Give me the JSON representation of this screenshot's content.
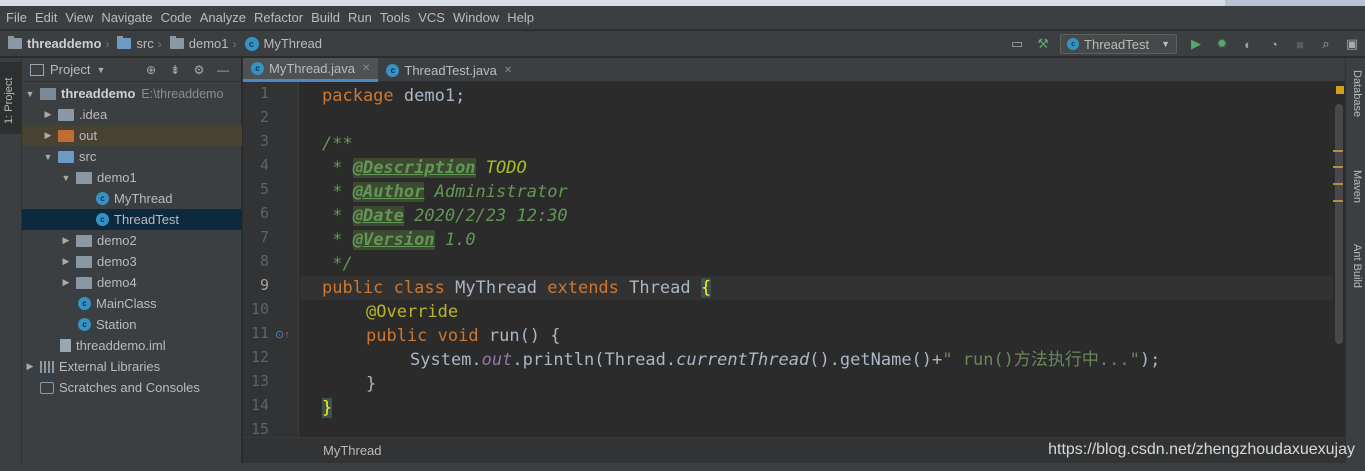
{
  "menu": [
    "File",
    "Edit",
    "View",
    "Navigate",
    "Code",
    "Analyze",
    "Refactor",
    "Build",
    "Run",
    "Tools",
    "VCS",
    "Window",
    "Help"
  ],
  "breadcrumbs": [
    {
      "label": "threaddemo",
      "icon": "folder-icon"
    },
    {
      "label": "src",
      "icon": "folder-icon"
    },
    {
      "label": "demo1",
      "icon": "folder-icon"
    },
    {
      "label": "MyThread",
      "icon": "class-icon"
    }
  ],
  "toolbar": {
    "run_config": "ThreadTest"
  },
  "left_stripe": {
    "project_tab": "1: Project"
  },
  "project_panel": {
    "title": "Project",
    "tree": [
      {
        "label": "threaddemo",
        "extra": "E:\\threaddemo",
        "depth": 0,
        "expanded": true,
        "kind": "module"
      },
      {
        "label": ".idea",
        "depth": 1,
        "expanded": false,
        "kind": "folder"
      },
      {
        "label": "out",
        "depth": 1,
        "expanded": false,
        "kind": "folder-out"
      },
      {
        "label": "src",
        "depth": 1,
        "expanded": true,
        "kind": "folder-src"
      },
      {
        "label": "demo1",
        "depth": 2,
        "expanded": true,
        "kind": "package"
      },
      {
        "label": "MyThread",
        "depth": 3,
        "kind": "class"
      },
      {
        "label": "ThreadTest",
        "depth": 3,
        "kind": "class",
        "selected": true
      },
      {
        "label": "demo2",
        "depth": 2,
        "expanded": false,
        "kind": "package"
      },
      {
        "label": "demo3",
        "depth": 2,
        "expanded": false,
        "kind": "package"
      },
      {
        "label": "demo4",
        "depth": 2,
        "expanded": false,
        "kind": "package"
      },
      {
        "label": "MainClass",
        "depth": 2,
        "kind": "class"
      },
      {
        "label": "Station",
        "depth": 2,
        "kind": "class"
      },
      {
        "label": "threaddemo.iml",
        "depth": 1,
        "kind": "iml"
      },
      {
        "label": "External Libraries",
        "depth": 0,
        "expanded": false,
        "kind": "libs"
      },
      {
        "label": "Scratches and Consoles",
        "depth": 0,
        "kind": "scratches"
      }
    ]
  },
  "tabs": [
    {
      "label": "MyThread.java",
      "active": true
    },
    {
      "label": "ThreadTest.java",
      "active": false
    }
  ],
  "editor": {
    "line_numbers": [
      "1",
      "2",
      "3",
      "4",
      "5",
      "6",
      "7",
      "8",
      "9",
      "10",
      "11",
      "12",
      "13",
      "14",
      "15"
    ],
    "current_line": "9",
    "code": {
      "l1_kw": "package",
      "l1_rest": " demo1;",
      "l3": "/**",
      "l4_star": " * ",
      "l4_tag": "@Description",
      "l4_text": " TODO",
      "l5_star": " * ",
      "l5_tag": "@Author",
      "l5_text": " Administrator",
      "l6_star": " * ",
      "l6_tag": "@Date",
      "l6_text": " 2020/2/23 12:30",
      "l7_star": " * ",
      "l7_tag": "@Version",
      "l7_text": " 1.0",
      "l8": " */",
      "l9_kw1": "public",
      "l9_kw2": "class",
      "l9_name": "MyThread",
      "l9_kw3": "extends",
      "l9_super": "Thread",
      "l9_brace": "{",
      "l10_ann": "@Override",
      "l11_kw1": "public",
      "l11_kw2": "void",
      "l11_rest": " run() {",
      "l12_a": "System.",
      "l12_out": "out",
      "l12_b": ".println(Thread.",
      "l12_ct": "currentThread",
      "l12_c": "().getName()+",
      "l12_str": "\" run()方法执行中...\"",
      "l12_d": ");",
      "l13": "}",
      "l14": "}"
    }
  },
  "right_stripe": [
    "Database",
    "Maven",
    "Ant Build"
  ],
  "footer": {
    "breadcrumb": "MyThread",
    "watermark": "https://blog.csdn.net/zhengzhoudaxuexujay"
  },
  "colors": {
    "background": "#2b2b2b",
    "keyword": "#cc7832",
    "comment": "#629755",
    "annotation": "#bbb529",
    "string": "#6a8759",
    "selection": "#0d293e"
  }
}
